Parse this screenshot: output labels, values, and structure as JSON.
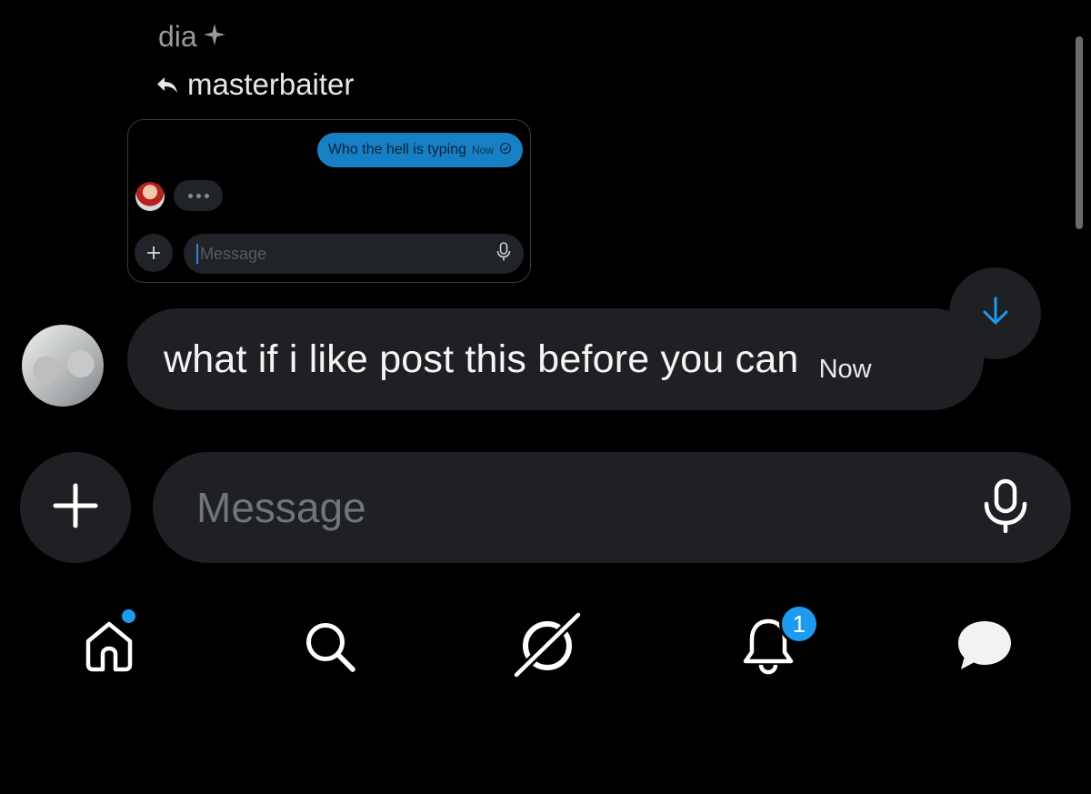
{
  "thread": {
    "sender_name": "dia",
    "sender_badge_icon": "sparkle-icon",
    "reply_to": "masterbaiter"
  },
  "quoted_card": {
    "bubble_text": "Who the hell is typing",
    "bubble_time": "Now",
    "input_placeholder": "Message"
  },
  "message": {
    "text": "what if i like post this before you can",
    "time": "Now"
  },
  "composer": {
    "placeholder": "Message"
  },
  "nav": {
    "notifications_badge": "1",
    "accent": "#1d9bf0",
    "items": [
      "home-icon",
      "search-icon",
      "grok-icon",
      "bell-icon",
      "messages-icon"
    ]
  }
}
